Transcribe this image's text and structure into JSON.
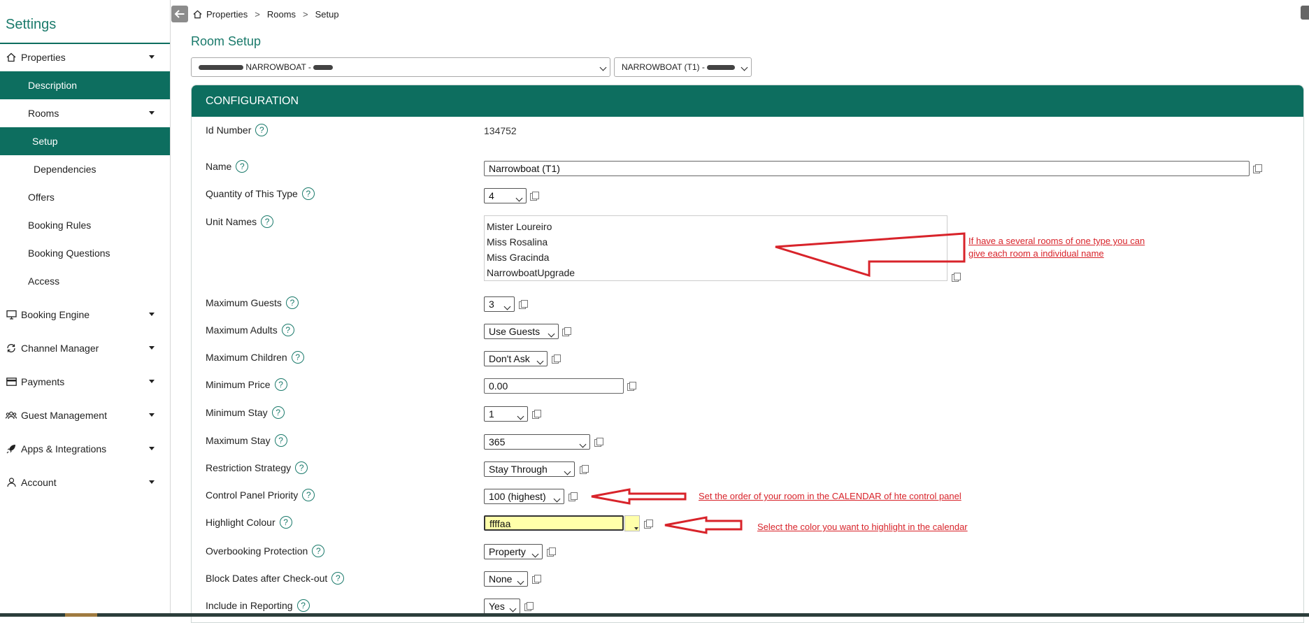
{
  "sidebar": {
    "settings_title": "Settings",
    "items": [
      {
        "label": "Properties",
        "icon": "home-icon",
        "level": 0,
        "expandable": true,
        "active": false
      },
      {
        "label": "Description",
        "level": 1,
        "active": true
      },
      {
        "label": "Rooms",
        "level": 1,
        "expandable": true,
        "active": false
      },
      {
        "label": "Setup",
        "level": 2,
        "active": true
      },
      {
        "label": "Dependencies",
        "level": 2,
        "active": false
      },
      {
        "label": "Offers",
        "level": 1,
        "active": false
      },
      {
        "label": "Booking Rules",
        "level": 1,
        "active": false
      },
      {
        "label": "Booking Questions",
        "level": 1,
        "active": false
      },
      {
        "label": "Access",
        "level": 1,
        "active": false
      },
      {
        "label": "Booking Engine",
        "icon": "monitor-icon",
        "level": 0,
        "expandable": true
      },
      {
        "label": "Channel Manager",
        "icon": "sync-icon",
        "level": 0,
        "expandable": true
      },
      {
        "label": "Payments",
        "icon": "credit-card-icon",
        "level": 0,
        "expandable": true
      },
      {
        "label": "Guest Management",
        "icon": "users-icon",
        "level": 0,
        "expandable": true
      },
      {
        "label": "Apps & Integrations",
        "icon": "rocket-icon",
        "level": 0,
        "expandable": true
      },
      {
        "label": "Account",
        "icon": "user-icon",
        "level": 0,
        "expandable": true
      }
    ]
  },
  "breadcrumb": [
    "Properties",
    "Rooms",
    "Setup"
  ],
  "page_title": "Room Setup",
  "property_select": {
    "value": "NARROWBOAT -"
  },
  "room_select": {
    "value": "NARROWBOAT (T1) -"
  },
  "panel_title": "CONFIGURATION",
  "fields": {
    "id_number": {
      "label": "Id Number",
      "value": "134752"
    },
    "name": {
      "label": "Name",
      "value": "Narrowboat (T1)"
    },
    "quantity": {
      "label": "Quantity of This Type",
      "value": "4"
    },
    "unit_names": {
      "label": "Unit Names",
      "values": [
        "Mister Loureiro",
        "Miss Rosalina",
        "Miss Gracinda",
        "NarrowboatUpgrade"
      ]
    },
    "max_guests": {
      "label": "Maximum Guests",
      "value": "3"
    },
    "max_adults": {
      "label": "Maximum Adults",
      "value": "Use Guests"
    },
    "max_children": {
      "label": "Maximum Children",
      "value": "Don't Ask"
    },
    "min_price": {
      "label": "Minimum Price",
      "value": "0.00"
    },
    "min_stay": {
      "label": "Minimum Stay",
      "value": "1"
    },
    "max_stay": {
      "label": "Maximum Stay",
      "value": "365"
    },
    "restriction": {
      "label": "Restriction Strategy",
      "value": "Stay Through"
    },
    "cp_priority": {
      "label": "Control Panel Priority",
      "value": "100 (highest)"
    },
    "highlight": {
      "label": "Highlight Colour",
      "value": "ffffaa"
    },
    "overbooking": {
      "label": "Overbooking Protection",
      "value": "Property"
    },
    "block_dates": {
      "label": "Block Dates after Check-out",
      "value": "None"
    },
    "reporting": {
      "label": "Include in Reporting",
      "value": "Yes"
    }
  },
  "annotations": {
    "unit_names_line1": "If have a several rooms of one type you can",
    "unit_names_line2": "give each room a individual name",
    "priority": "Set the order of your room in the CALENDAR of hte control panel",
    "highlight": "Select the color you want to highlight in the calendar"
  },
  "colors": {
    "brand": "#0d6e5f",
    "annotation": "#d8232a",
    "highlight_swatch": "#ffffaa"
  }
}
